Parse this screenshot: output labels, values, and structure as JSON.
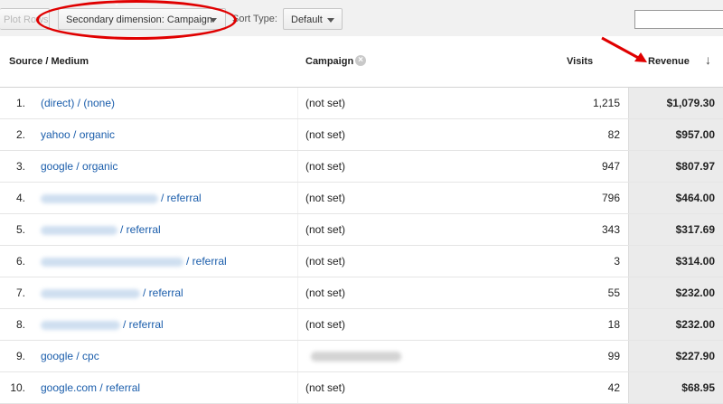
{
  "toolbar": {
    "plot_rows_label": "Plot Rows",
    "secondary_dimension_label": "Secondary dimension: Campaign",
    "sort_type_label": "Sort Type:",
    "sort_type_value": "Default",
    "search_value": ""
  },
  "table": {
    "headers": {
      "source_medium": "Source / Medium",
      "campaign": "Campaign",
      "visits": "Visits",
      "revenue": "Revenue"
    },
    "rows": [
      {
        "num": "1.",
        "source": "(direct) / (none)",
        "blurred": false,
        "campaign": "(not set)",
        "visits": "1,215",
        "revenue": "$1,079.30"
      },
      {
        "num": "2.",
        "source": "yahoo / organic",
        "blurred": false,
        "campaign": "(not set)",
        "visits": "82",
        "revenue": "$957.00"
      },
      {
        "num": "3.",
        "source": "google / organic",
        "blurred": false,
        "campaign": "(not set)",
        "visits": "947",
        "revenue": "$807.97"
      },
      {
        "num": "4.",
        "source": "/ referral",
        "blurred": true,
        "campaign": "(not set)",
        "visits": "796",
        "revenue": "$464.00"
      },
      {
        "num": "5.",
        "source": "/ referral",
        "blurred": true,
        "campaign": "(not set)",
        "visits": "343",
        "revenue": "$317.69"
      },
      {
        "num": "6.",
        "source": "/ referral",
        "blurred": true,
        "campaign": "(not set)",
        "visits": "3",
        "revenue": "$314.00"
      },
      {
        "num": "7.",
        "source": "/ referral",
        "blurred": true,
        "campaign": "(not set)",
        "visits": "55",
        "revenue": "$232.00"
      },
      {
        "num": "8.",
        "source": "/ referral",
        "blurred": true,
        "campaign": "(not set)",
        "visits": "18",
        "revenue": "$232.00"
      },
      {
        "num": "9.",
        "source": "google / cpc",
        "blurred": false,
        "campaign": "",
        "campaign_blurred": true,
        "visits": "99",
        "revenue": "$227.90"
      },
      {
        "num": "10.",
        "source": "google.com / referral",
        "blurred": false,
        "campaign": "(not set)",
        "visits": "42",
        "revenue": "$68.95"
      }
    ]
  },
  "colors": {
    "link": "#1a5dab",
    "annotation": "#e00000",
    "sorted_column_bg": "#ebebeb"
  }
}
